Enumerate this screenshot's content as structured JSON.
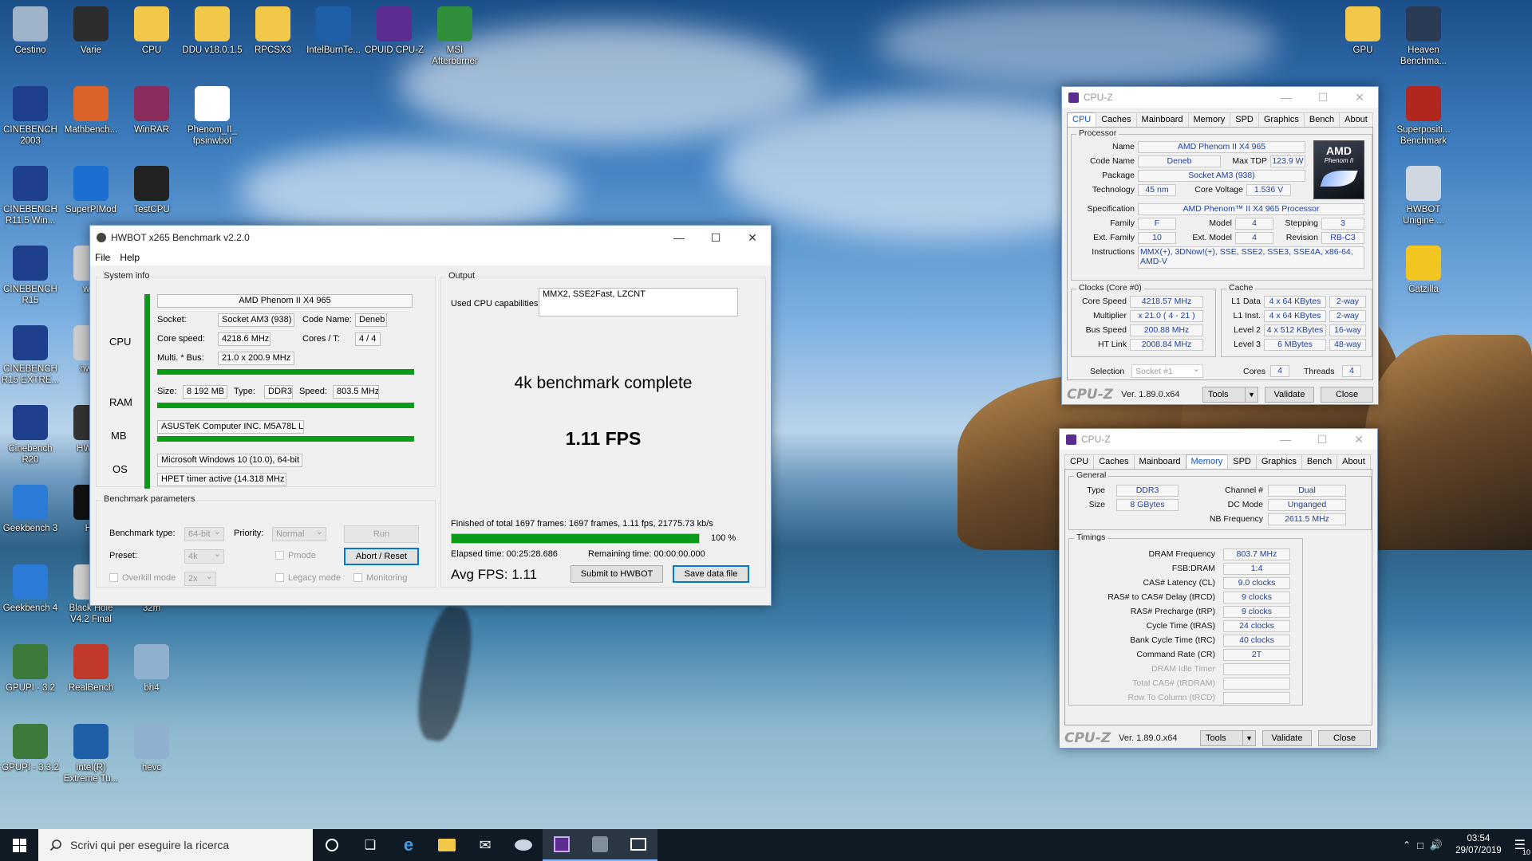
{
  "desktop": {
    "icons": [
      {
        "label": "Cestino",
        "icon": "recycle-bin-icon",
        "color": "#9fb3c8"
      },
      {
        "label": "Varie",
        "icon": "folder-icon",
        "color": "#2d2d2d"
      },
      {
        "label": "CPU",
        "icon": "folder-icon",
        "color": "#f2c84b"
      },
      {
        "label": "DDU v18.0.1.5",
        "icon": "folder-icon",
        "color": "#f2c84b"
      },
      {
        "label": "RPCSX3",
        "icon": "folder-icon",
        "color": "#f2c84b"
      },
      {
        "label": "IntelBurnTe...",
        "icon": "intel-icon",
        "color": "#1e5fa8"
      },
      {
        "label": "CPUID CPU-Z",
        "icon": "cpuz-icon",
        "color": "#5b2d91"
      },
      {
        "label": "MSI Afterburner",
        "icon": "afterburner-icon",
        "color": "#2f8f3a"
      },
      {
        "label": "CINEBENCH 2003",
        "icon": "cinebench-icon",
        "color": "#1d3f8c"
      },
      {
        "label": "Mathbench...",
        "icon": "pi-icon",
        "color": "#d9632b"
      },
      {
        "label": "WinRAR",
        "icon": "winrar-icon",
        "color": "#8a2d5c"
      },
      {
        "label": "Phenom_II_ fpsinwbot",
        "icon": "file-icon",
        "color": "#ffffff"
      },
      {
        "label": "CINEBENCH R11.5 Win...",
        "icon": "cinebench-icon",
        "color": "#1d3f8c"
      },
      {
        "label": "SuperPIMod",
        "icon": "superpi-icon",
        "color": "#1b6fd1"
      },
      {
        "label": "TestCPU",
        "icon": "chip-icon",
        "color": "#222222"
      },
      {
        "label": "CINEBENCH R15",
        "icon": "cinebench-icon",
        "color": "#1d3f8c"
      },
      {
        "label": "wPr",
        "icon": "app-icon",
        "color": "#cccccc"
      },
      {
        "label": "CINEBENCH R15 EXTRE...",
        "icon": "cinebench-icon",
        "color": "#1d3f8c"
      },
      {
        "label": "hwbo",
        "icon": "app-icon",
        "color": "#cccccc"
      },
      {
        "label": "Cinebench R20",
        "icon": "cinebench-icon",
        "color": "#1d3f8c"
      },
      {
        "label": "HWBO",
        "icon": "app-icon",
        "color": "#333333"
      },
      {
        "label": "Geekbench 3",
        "icon": "geekbench-icon",
        "color": "#2c7bd6"
      },
      {
        "label": "HL",
        "icon": "app-icon",
        "color": "#111111"
      },
      {
        "label": "Geekbench 4",
        "icon": "geekbench-icon",
        "color": "#2c7bd6"
      },
      {
        "label": "Black Hole V4.2 Final",
        "icon": "app-icon",
        "color": "#cfcfcf"
      },
      {
        "label": "32m",
        "icon": "app-icon",
        "color": "#cccccc"
      },
      {
        "label": "GPUPI - 3.2",
        "icon": "gpupi-icon",
        "color": "#3c7a3c"
      },
      {
        "label": "RealBench",
        "icon": "realbench-icon",
        "color": "#c0392b"
      },
      {
        "label": "bh4",
        "icon": "app-icon",
        "color": "#8fb0cf"
      },
      {
        "label": "GPUPI - 3.3.2",
        "icon": "gpupi-icon",
        "color": "#3c7a3c"
      },
      {
        "label": "Intel(R) Extreme Tu...",
        "icon": "intel-icon",
        "color": "#1e5fa8"
      },
      {
        "label": "hevc",
        "icon": "app-icon",
        "color": "#8fb0cf"
      },
      {
        "label": "GPU",
        "icon": "folder-icon",
        "color": "#f2c84b"
      },
      {
        "label": "Heaven Benchma...",
        "icon": "heaven-icon",
        "color": "#2a3b55"
      },
      {
        "label": "Superpositi... Benchmark",
        "icon": "superposition-icon",
        "color": "#b1261f"
      },
      {
        "label": "HWBOT Unigine ...",
        "icon": "hwbot-icon",
        "color": "#cfd8e0"
      },
      {
        "label": "Catzilla",
        "icon": "catzilla-icon",
        "color": "#f2c520"
      }
    ]
  },
  "hwbot": {
    "title": "HWBOT x265 Benchmark v2.2.0",
    "menu": [
      "File",
      "Help"
    ],
    "system_info": {
      "group_title": "System info",
      "cpu_label": "CPU",
      "ram_label": "RAM",
      "mb_label": "MB",
      "os_label": "OS",
      "cpu_name": "AMD Phenom II X4 965",
      "socket_label": "Socket:",
      "socket_value": "Socket AM3 (938)",
      "codename_label": "Code Name:",
      "codename_value": "Deneb",
      "core_speed_label": "Core speed:",
      "core_speed_value": "4218.6 MHz",
      "cores_label": "Cores / T:",
      "cores_value": "4 / 4",
      "multi_label": "Multi. * Bus:",
      "multi_value": "21.0 x 200.9 MHz",
      "size_label": "Size:",
      "size_value": "8 192 MB",
      "type_label": "Type:",
      "type_value": "DDR3",
      "speed_label": "Speed:",
      "speed_value": "803.5 MHz",
      "mb_value": "ASUSTeK Computer INC. M5A78L LE",
      "os_value": "Microsoft Windows 10 (10.0), 64-bit",
      "timer_value": "HPET timer active (14.318 MHz )"
    },
    "output": {
      "group_title": "Output",
      "caps_label": "Used CPU capabilities:",
      "caps_value": "MMX2, SSE2Fast, LZCNT",
      "status": "4k benchmark complete",
      "fps": "1.11 FPS",
      "finished": "Finished of total 1697 frames: 1697 frames, 1.11 fps,  21775.73 kb/s",
      "progress_pct": 100,
      "progress_text": "100 %",
      "elapsed": "Elapsed time: 00:25:28.686",
      "remaining": "Remaining time: 00:00:00.000",
      "avg_fps": "Avg FPS: 1.11",
      "submit_label": "Submit to HWBOT",
      "save_label": "Save data file"
    },
    "params": {
      "group_title": "Benchmark parameters",
      "bench_type_label": "Benchmark type:",
      "bench_type_value": "64-bit",
      "priority_label": "Priority:",
      "priority_value": "Normal",
      "run_label": "Run",
      "preset_label": "Preset:",
      "preset_value": "4k",
      "pmode_label": "Pmode",
      "abort_label": "Abort / Reset",
      "overkill_label": "Overkill mode",
      "overkill_value": "2x",
      "legacy_label": "Legacy mode",
      "monitoring_label": "Monitoring"
    }
  },
  "cpuz1": {
    "title": "CPU-Z",
    "tabs": [
      "CPU",
      "Caches",
      "Mainboard",
      "Memory",
      "SPD",
      "Graphics",
      "Bench",
      "About"
    ],
    "active_tab": "CPU",
    "processor_title": "Processor",
    "name_label": "Name",
    "name_value": "AMD Phenom II X4 965",
    "codename_label": "Code Name",
    "codename_value": "Deneb",
    "maxtdp_label": "Max TDP",
    "maxtdp_value": "123.9 W",
    "package_label": "Package",
    "package_value": "Socket AM3 (938)",
    "tech_label": "Technology",
    "tech_value": "45 nm",
    "voltage_label": "Core Voltage",
    "voltage_value": "1.536 V",
    "spec_label": "Specification",
    "spec_value": "AMD Phenom™ II X4 965 Processor",
    "family_label": "Family",
    "family_value": "F",
    "model_label": "Model",
    "model_value": "4",
    "stepping_label": "Stepping",
    "stepping_value": "3",
    "extfamily_label": "Ext. Family",
    "extfamily_value": "10",
    "extmodel_label": "Ext. Model",
    "extmodel_value": "4",
    "revision_label": "Revision",
    "revision_value": "RB-C3",
    "instr_label": "Instructions",
    "instr_value": "MMX(+), 3DNow!(+), SSE, SSE2, SSE3, SSE4A, x86-64, AMD-V",
    "logo_top": "AMD",
    "logo_bottom": "Phenom II",
    "clocks_title": "Clocks (Core #0)",
    "corespeed_label": "Core Speed",
    "corespeed_value": "4218.57 MHz",
    "multiplier_label": "Multiplier",
    "multiplier_value": "x 21.0 ( 4 - 21 )",
    "busspeed_label": "Bus Speed",
    "busspeed_value": "200.88 MHz",
    "htlink_label": "HT Link",
    "htlink_value": "2008.84 MHz",
    "cache_title": "Cache",
    "l1d_label": "L1 Data",
    "l1d_value": "4 x 64 KBytes",
    "l1d_way": "2-way",
    "l1i_label": "L1 Inst.",
    "l1i_value": "4 x 64 KBytes",
    "l1i_way": "2-way",
    "l2_label": "Level 2",
    "l2_value": "4 x 512 KBytes",
    "l2_way": "16-way",
    "l3_label": "Level 3",
    "l3_value": "6 MBytes",
    "l3_way": "48-way",
    "selection_label": "Selection",
    "selection_value": "Socket #1",
    "cores_label": "Cores",
    "cores_value": "4",
    "threads_label": "Threads",
    "threads_value": "4",
    "logo": "CPU-Z",
    "version": "Ver. 1.89.0.x64",
    "tools_label": "Tools",
    "validate_label": "Validate",
    "close_label": "Close"
  },
  "cpuz2": {
    "title": "CPU-Z",
    "tabs": [
      "CPU",
      "Caches",
      "Mainboard",
      "Memory",
      "SPD",
      "Graphics",
      "Bench",
      "About"
    ],
    "active_tab": "Memory",
    "general_title": "General",
    "type_label": "Type",
    "type_value": "DDR3",
    "size_label": "Size",
    "size_value": "8 GBytes",
    "channel_label": "Channel #",
    "channel_value": "Dual",
    "dcmode_label": "DC Mode",
    "dcmode_value": "Unganged",
    "nbfreq_label": "NB Frequency",
    "nbfreq_value": "2611.5 MHz",
    "timings_title": "Timings",
    "timings": [
      {
        "label": "DRAM Frequency",
        "value": "803.7 MHz",
        "dim": false
      },
      {
        "label": "FSB:DRAM",
        "value": "1:4",
        "dim": false
      },
      {
        "label": "CAS# Latency (CL)",
        "value": "9.0 clocks",
        "dim": false
      },
      {
        "label": "RAS# to CAS# Delay (tRCD)",
        "value": "9 clocks",
        "dim": false
      },
      {
        "label": "RAS# Precharge (tRP)",
        "value": "9 clocks",
        "dim": false
      },
      {
        "label": "Cycle Time (tRAS)",
        "value": "24 clocks",
        "dim": false
      },
      {
        "label": "Bank Cycle Time (tRC)",
        "value": "40 clocks",
        "dim": false
      },
      {
        "label": "Command Rate (CR)",
        "value": "2T",
        "dim": false
      },
      {
        "label": "DRAM Idle Timer",
        "value": "",
        "dim": true
      },
      {
        "label": "Total CAS# (tRDRAM)",
        "value": "",
        "dim": true
      },
      {
        "label": "Row To Column (tRCD)",
        "value": "",
        "dim": true
      }
    ],
    "logo": "CPU-Z",
    "version": "Ver. 1.89.0.x64",
    "tools_label": "Tools",
    "validate_label": "Validate",
    "close_label": "Close"
  },
  "taskbar": {
    "search_placeholder": "Scrivi qui per eseguire la ricerca",
    "time": "03:54",
    "date": "29/07/2019",
    "notification_count": "10"
  },
  "colors": {
    "progress_green": "#0a9b18",
    "cpuz_value_blue": "#1f3f99",
    "active_tab_blue": "#0d56c9",
    "taskbar": "#101a24"
  }
}
